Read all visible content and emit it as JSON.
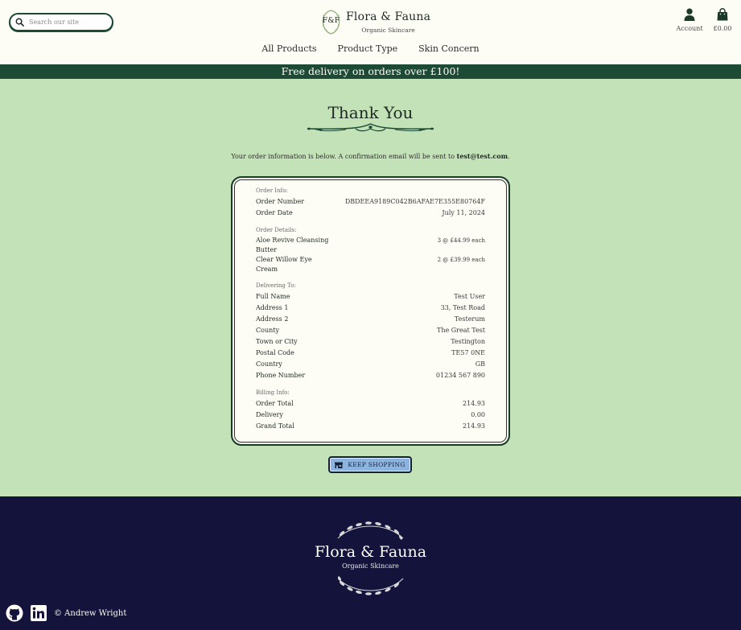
{
  "header": {
    "search_placeholder": "Search our site",
    "brand_monogram": "F&F",
    "brand_name": "Flora & Fauna",
    "brand_tagline": "Organic Skincare",
    "account_label": "Account",
    "basket_total": "£0.00"
  },
  "nav": [
    "All Products",
    "Product Type",
    "Skin Concern"
  ],
  "banner": "Free delivery on orders over £100!",
  "page": {
    "title": "Thank You",
    "intro": "Your order information is below. A confirmation email will be sent to ",
    "email": "test@test.com",
    "intro_end": "."
  },
  "order": {
    "info_label": "Order Info:",
    "number_label": "Order Number",
    "number": "DBDEEA9189C042B6AFAE7E355E80764F",
    "date_label": "Order Date",
    "date": "July 11, 2024",
    "details_label": "Order Details:",
    "items": [
      {
        "name": "Aloe Revive Cleansing Butter",
        "qty": "3 @ £44.99 each"
      },
      {
        "name": "Clear Willow Eye Cream",
        "qty": "2 @ £39.99 each"
      }
    ],
    "delivery_label": "Delivering To:",
    "delivery": [
      {
        "k": "Full Name",
        "v": "Test User"
      },
      {
        "k": "Address 1",
        "v": "33, Test Road"
      },
      {
        "k": "Address 2",
        "v": "Testerum"
      },
      {
        "k": "County",
        "v": "The Great Test"
      },
      {
        "k": "Town or City",
        "v": "Testington"
      },
      {
        "k": "Postal Code",
        "v": "TE57 0NE"
      },
      {
        "k": "Country",
        "v": "GB"
      },
      {
        "k": "Phone Number",
        "v": "01234 567 890"
      }
    ],
    "billing_label": "Billing Info:",
    "billing": [
      {
        "k": "Order Total",
        "v": "214.93"
      },
      {
        "k": "Delivery",
        "v": "0.00"
      },
      {
        "k": "Grand Total",
        "v": "214.93"
      }
    ]
  },
  "keep_shopping": "KEEP SHOPPING",
  "footer": {
    "brand_name": "Flora & Fauna",
    "brand_tagline": "Organic Skincare",
    "copyright": "© Andrew Wright"
  },
  "colors": {
    "page_bg": "#c4e2b7",
    "header_bg": "#fdfcf5",
    "banner_bg": "#1c4a34",
    "footer_bg": "#13133c",
    "button_bg": "#8db3df"
  }
}
